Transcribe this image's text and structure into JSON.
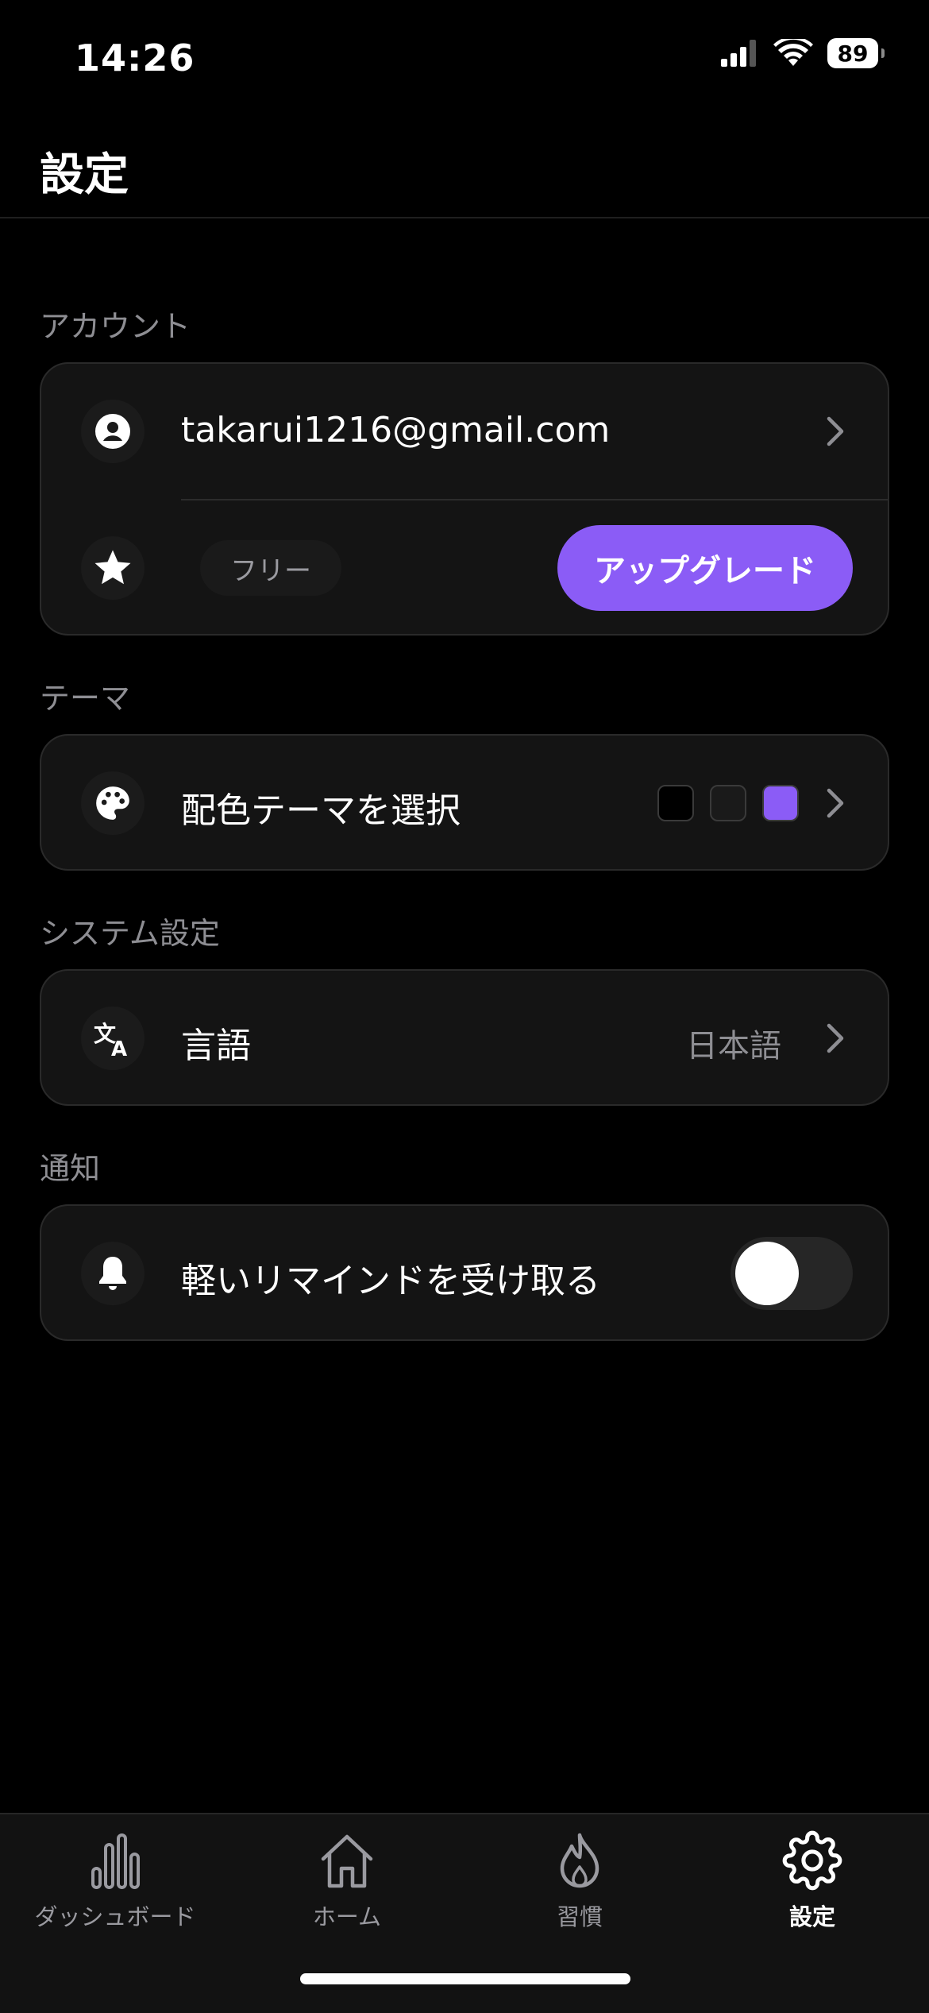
{
  "status_bar": {
    "time": "14:26",
    "battery": "89"
  },
  "header": {
    "title": "設定"
  },
  "account": {
    "section_label": "アカウント",
    "email": "takarui1216@gmail.com",
    "plan": "フリー",
    "upgrade_label": "アップグレード"
  },
  "theme": {
    "section_label": "テーマ",
    "row_label": "配色テーマを選択",
    "swatches": [
      "#000000",
      "#1a1a1a",
      "#8b5cf6"
    ]
  },
  "system": {
    "section_label": "システム設定",
    "language_label": "言語",
    "language_value": "日本語"
  },
  "notifications": {
    "section_label": "通知",
    "reminder_label": "軽いリマインドを受け取る",
    "reminder_enabled": false
  },
  "tabbar": {
    "items": [
      {
        "label": "ダッシュボード",
        "icon": "bar-chart-icon",
        "active": false
      },
      {
        "label": "ホーム",
        "icon": "home-icon",
        "active": false
      },
      {
        "label": "習慣",
        "icon": "flame-icon",
        "active": false
      },
      {
        "label": "設定",
        "icon": "gear-icon",
        "active": true
      }
    ]
  },
  "colors": {
    "accent": "#8b5cf6",
    "background": "#000000",
    "card": "#141414"
  }
}
